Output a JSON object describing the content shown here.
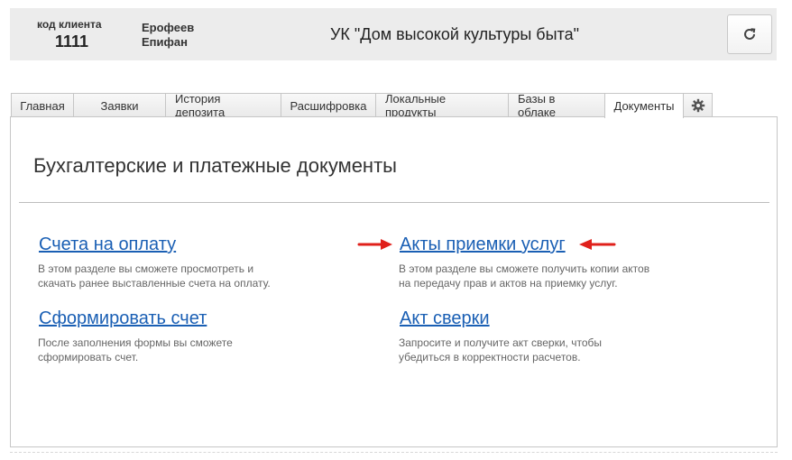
{
  "header": {
    "client_code_label": "код клиента",
    "client_code": "1111",
    "client_name_line1": "Ерофеев",
    "client_name_line2": "Епифан",
    "org_title": "УК \"Дом высокой культуры быта\"",
    "refresh_icon": "refresh-icon"
  },
  "tabs": [
    {
      "label": "Главная"
    },
    {
      "label": "Заявки"
    },
    {
      "label": "История депозита"
    },
    {
      "label": "Расшифровка"
    },
    {
      "label": "Локальные продукты"
    },
    {
      "label": "Базы в облаке"
    },
    {
      "label": "Документы",
      "active": true
    },
    {
      "icon": "gear-icon"
    }
  ],
  "main": {
    "title": "Бухгалтерские и платежные документы",
    "items": [
      {
        "link": "Счета на оплату",
        "desc": "В этом разделе вы сможете просмотреть и\nскачать ранее выставленные счета на оплату."
      },
      {
        "link": "Акты приемки услуг",
        "desc": "В этом разделе вы сможете получить копии актов\nна передачу прав и актов на приемку услуг."
      },
      {
        "link": "Сформировать счет",
        "desc": "После заполнения формы вы сможете\nсформировать счет."
      },
      {
        "link": "Акт сверки",
        "desc": "Запросите и получите акт сверки, чтобы\nубедиться в корректности расчетов."
      }
    ]
  },
  "colors": {
    "link": "#1a5fb4",
    "arrow": "#e0201b",
    "header_bg": "#ececec"
  }
}
